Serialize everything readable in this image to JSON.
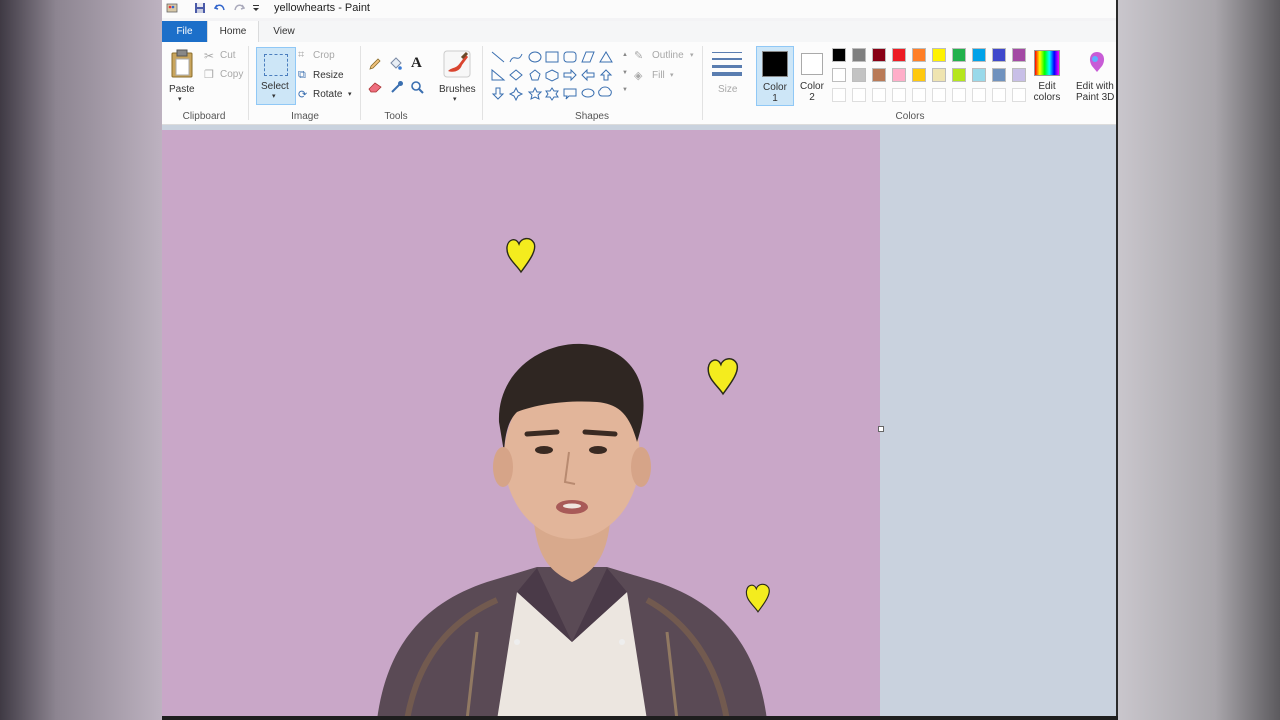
{
  "window": {
    "title": "yellowhearts - Paint"
  },
  "tabs": [
    {
      "label": "File"
    },
    {
      "label": "Home"
    },
    {
      "label": "View"
    }
  ],
  "clipboard": {
    "paste_label": "Paste",
    "cut_label": "Cut",
    "copy_label": "Copy",
    "group_label": "Clipboard"
  },
  "image": {
    "select_label": "Select",
    "crop_label": "Crop",
    "resize_label": "Resize",
    "rotate_label": "Rotate",
    "group_label": "Image"
  },
  "tools": {
    "group_label": "Tools",
    "items": [
      "pencil-icon",
      "fill-bucket-icon",
      "text-icon",
      "eraser-icon",
      "color-picker-icon",
      "magnifier-icon"
    ]
  },
  "brushes": {
    "label": "Brushes"
  },
  "shapes": {
    "group_label": "Shapes",
    "outline_label": "Outline",
    "fill_label": "Fill"
  },
  "size": {
    "label": "Size"
  },
  "colors": {
    "group_label": "Colors",
    "color1_label": "Color 1",
    "color2_label": "Color 2",
    "color1": "#000000",
    "color2": "#ffffff",
    "edit_colors_label": "Edit colors",
    "edit_paint3d_label": "Edit with Paint 3D",
    "palette_row1": [
      "#000000",
      "#7f7f7f",
      "#880015",
      "#ed1c24",
      "#ff7f27",
      "#fff200",
      "#22b14c",
      "#00a2e8",
      "#3f48cc",
      "#a349a4"
    ],
    "palette_row2": [
      "#ffffff",
      "#c3c3c3",
      "#b97a57",
      "#ffaec9",
      "#ffc90e",
      "#efe4b0",
      "#b5e61d",
      "#99d9ea",
      "#7092be",
      "#c8bfe7"
    ],
    "palette_row3": [
      "#ffffff",
      "#ffffff",
      "#ffffff",
      "#ffffff",
      "#ffffff",
      "#ffffff",
      "#ffffff",
      "#ffffff",
      "#ffffff",
      "#ffffff"
    ]
  },
  "canvas": {
    "background": "#c9a7c8",
    "heart_color": "#f4ec1e",
    "hearts": [
      "heart",
      "heart",
      "heart"
    ]
  }
}
